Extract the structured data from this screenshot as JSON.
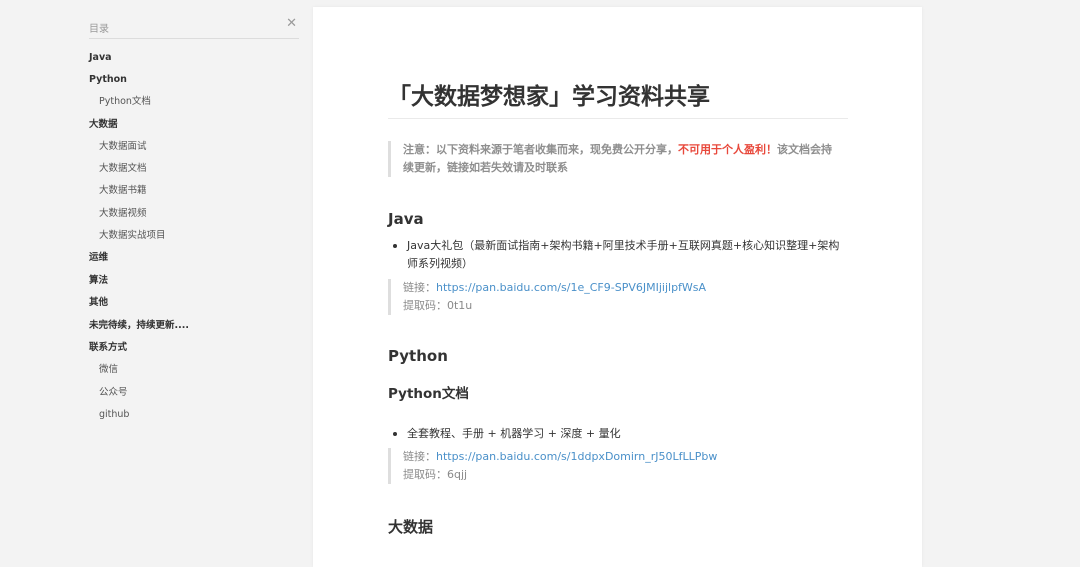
{
  "toc": {
    "title": "目录",
    "close_icon": "close-icon",
    "items": [
      {
        "label": "Java",
        "level": 1
      },
      {
        "label": "Python",
        "level": 1
      },
      {
        "label": "Python文档",
        "level": 2
      },
      {
        "label": "大数据",
        "level": 1
      },
      {
        "label": "大数据面试",
        "level": 2
      },
      {
        "label": "大数据文档",
        "level": 2
      },
      {
        "label": "大数据书籍",
        "level": 2
      },
      {
        "label": "大数据视频",
        "level": 2
      },
      {
        "label": "大数据实战项目",
        "level": 2
      },
      {
        "label": "运维",
        "level": 1
      },
      {
        "label": "算法",
        "level": 1
      },
      {
        "label": "其他",
        "level": 1
      },
      {
        "label": "未完待续，持续更新....",
        "level": 1
      },
      {
        "label": "联系方式",
        "level": 1
      },
      {
        "label": "微信",
        "level": 2
      },
      {
        "label": "公众号",
        "level": 2
      },
      {
        "label": "github",
        "level": 2
      }
    ]
  },
  "article": {
    "title": "「大数据梦想家」学习资料共享",
    "notice": {
      "before": "注意：以下资料来源于笔者收集而来，现免费公开分享，",
      "warning": "不可用于个人盈利！",
      "after": "该文档会持续更新，链接如若失效请及时联系"
    },
    "java": {
      "heading": "Java",
      "bullet": "Java大礼包（最新面试指南+架构书籍+阿里技术手册+互联网真题+核心知识整理+架构师系列视频）",
      "link_label": "链接：",
      "link_url": "https://pan.baidu.com/s/1e_CF9-SPV6JMIjijlpfWsA",
      "code_label": "提取码：",
      "code": "0t1u"
    },
    "python": {
      "heading": "Python",
      "subheading": "Python文档",
      "bullet": "全套教程、手册 + 机器学习 + 深度 + 量化",
      "link_label": "链接：",
      "link_url": "https://pan.baidu.com/s/1ddpxDomirn_rJ50LfLLPbw",
      "code_label": "提取码：",
      "code": "6qjj"
    },
    "bigdata": {
      "heading": "大数据"
    }
  },
  "colors": {
    "background": "#f3f3f3",
    "card": "#ffffff",
    "link": "#4a90c9",
    "warning": "#e8483b",
    "text": "#333333",
    "muted": "#8a8a8a"
  }
}
